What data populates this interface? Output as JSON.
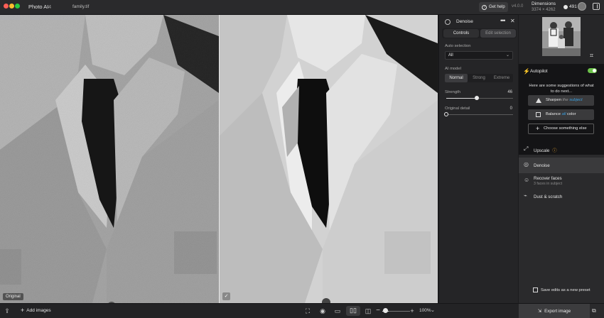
{
  "titlebar": {
    "app_name": "Photo AI",
    "app_version": "4",
    "file_name": "family.tif",
    "help_label": "Get help",
    "version": "v4.0.0",
    "dimensions_label": "Dimensions",
    "dimensions_value": "3374 × 4262",
    "credits": "491"
  },
  "canvas": {
    "original_badge": "Original",
    "processed_badge_icon": "checkmark-icon"
  },
  "bottombar": {
    "add_images_label": "Add images",
    "zoom_value": "100%",
    "zoom_level": 0.3
  },
  "denoise": {
    "title": "Denoise",
    "tabs": [
      "Controls",
      "Edit selection"
    ],
    "active_tab": "Controls",
    "auto_selection_label": "Auto selection",
    "auto_selection_value": "All",
    "ai_model_label": "AI model",
    "models": [
      "Normal",
      "Strong",
      "Extreme"
    ],
    "selected_model": "Normal",
    "strength_label": "Strength",
    "strength_value": "46",
    "strength_level": 0.46,
    "original_detail_label": "Original detail",
    "original_detail_value": "0",
    "original_detail_level": 0.0
  },
  "sidebar": {
    "autopilot_label": "Autopilot",
    "autopilot_enabled": true,
    "suggestions_text": "Here are some suggestions of what to do next...",
    "suggestion_1_prefix": "Sharpen",
    "suggestion_1_mid": "the",
    "suggestion_1_highlight": "subject",
    "suggestion_2_prefix": "Balance",
    "suggestion_2_highlight": "all",
    "suggestion_2_suffix": "color",
    "choose_else_label": "Choose something else",
    "tools": [
      {
        "label": "Upscale",
        "sub": "",
        "icon": "expand-icon"
      },
      {
        "label": "Denoise",
        "sub": "",
        "icon": "denoise-icon"
      },
      {
        "label": "Recover faces",
        "sub": "3 faces in subject",
        "icon": "face-icon"
      },
      {
        "label": "Dust & scratch",
        "sub": "",
        "icon": "brush-icon"
      }
    ],
    "active_tool": "Denoise",
    "save_preset_label": "Save edits as a new preset",
    "export_label": "Export image"
  },
  "colors": {
    "accent_green": "#6cc24a",
    "highlight_blue": "#3aa0e0",
    "warning_orange": "#e0a030"
  }
}
